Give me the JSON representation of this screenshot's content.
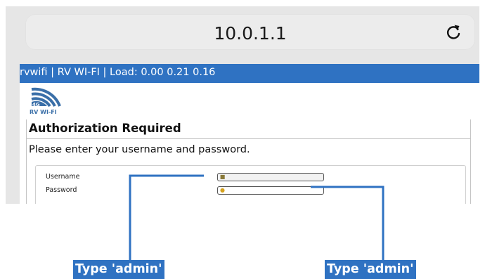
{
  "browser": {
    "url": "10.0.1.1",
    "reload_icon": "reload-icon"
  },
  "page": {
    "topbar_text": "rvwifi | RV WI-FI | Load: 0.00 0.21 0.16",
    "logo_text": "RV WI-FI",
    "logo_mark": "4G",
    "heading": "Authorization Required",
    "prompt": "Please enter your username and password.",
    "form": {
      "username_label": "Username",
      "password_label": "Password",
      "username_value": "",
      "password_value": "",
      "username_icon": "user-icon",
      "password_icon": "key-icon"
    }
  },
  "callouts": {
    "username_instruction": "Type 'admin'",
    "password_instruction": "Type 'admin'"
  },
  "colors": {
    "accent": "#2f72c2",
    "browser_chrome": "#e6e6e6"
  }
}
